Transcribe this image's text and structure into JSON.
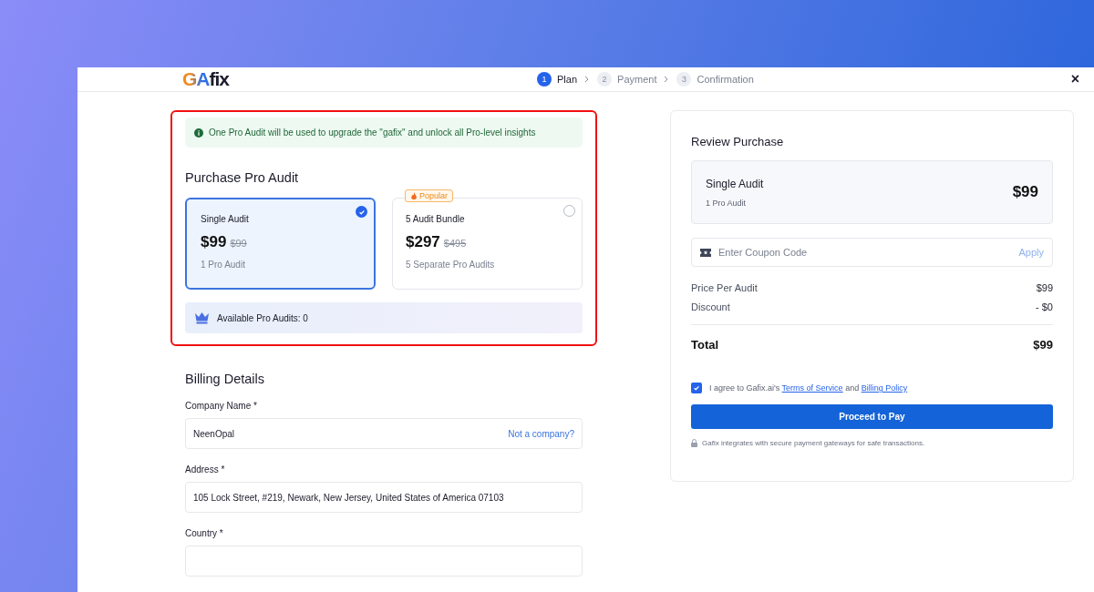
{
  "header": {
    "logo": {
      "accent": "GA",
      "rest": "fix"
    },
    "steps": [
      {
        "number": "1",
        "label": "Plan",
        "selected": true
      },
      {
        "number": "2",
        "label": "Payment",
        "selected": false
      },
      {
        "number": "3",
        "label": "Confirmation",
        "selected": false
      }
    ],
    "close": "×"
  },
  "notice": "One Pro Audit will be used to upgrade the \"gafix\" and unlock all Pro-level insights",
  "purchase": {
    "title": "Purchase Pro Audit",
    "plans": [
      {
        "name": "Single Audit",
        "price": "$99",
        "old_price": "$99",
        "note": "1 Pro Audit",
        "selected": true
      },
      {
        "name": "5 Audit Bundle",
        "price": "$297",
        "old_price": "$495",
        "note": "5 Separate Pro Audits",
        "selected": false,
        "badge": "Popular"
      }
    ],
    "available": "Available Pro Audits: 0"
  },
  "billing": {
    "title": "Billing Details",
    "fields": [
      {
        "label": "Company Name *",
        "value": "NeenOpal",
        "link": "Not a company?"
      },
      {
        "label": "Address *",
        "value": "105 Lock Street, #219, Newark, New Jersey, United States of America 07103"
      },
      {
        "label": "Country *"
      }
    ]
  },
  "review": {
    "title": "Review Purchase",
    "item": {
      "name": "Single Audit",
      "note": "1 Pro Audit",
      "price": "$99"
    },
    "coupon": {
      "placeholder": "Enter Coupon Code",
      "button": "Apply"
    },
    "lines": [
      {
        "label": "Price Per Audit",
        "value": "$99"
      },
      {
        "label": "Discount",
        "value": "- $0"
      }
    ],
    "total": {
      "label": "Total",
      "value": "$99"
    },
    "agree": {
      "checked": true,
      "text": "I agree to Gafix.ai's",
      "link1": "Terms of Service",
      "and": "and",
      "link2": "Billing Policy"
    },
    "pay": "Proceed to Pay",
    "secure": "Gafix integrates with secure payment gateways for safe transactions."
  }
}
